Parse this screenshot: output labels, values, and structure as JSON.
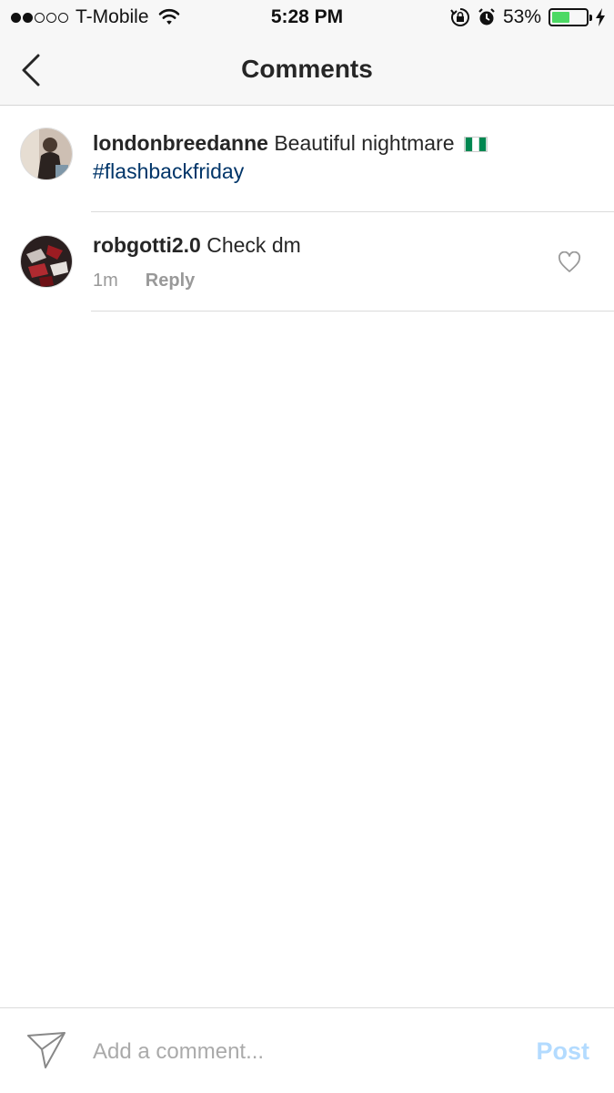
{
  "status_bar": {
    "carrier": "T-Mobile",
    "time": "5:28 PM",
    "battery_percent": "53%",
    "battery_level": 0.53,
    "signal_strength": 2,
    "icons": [
      "wifi-icon",
      "rotation-lock-icon",
      "alarm-icon",
      "battery-icon",
      "charging-icon"
    ]
  },
  "header": {
    "title": "Comments",
    "back_icon": "chevron-left-icon"
  },
  "comments": [
    {
      "username": "londonbreedanne",
      "text": "Beautiful nightmare",
      "emoji": "nigeria-flag",
      "hashtag": "#flashbackfriday"
    },
    {
      "username": "robgotti2.0",
      "text": "Check dm",
      "time": "1m",
      "reply_label": "Reply",
      "like_icon": "heart-icon"
    }
  ],
  "composer": {
    "placeholder": "Add a comment...",
    "post_label": "Post",
    "send_icon": "paper-plane-icon"
  },
  "colors": {
    "hashtag": "#003569",
    "post_disabled": "#b3dbff",
    "battery": "#4cd964"
  }
}
